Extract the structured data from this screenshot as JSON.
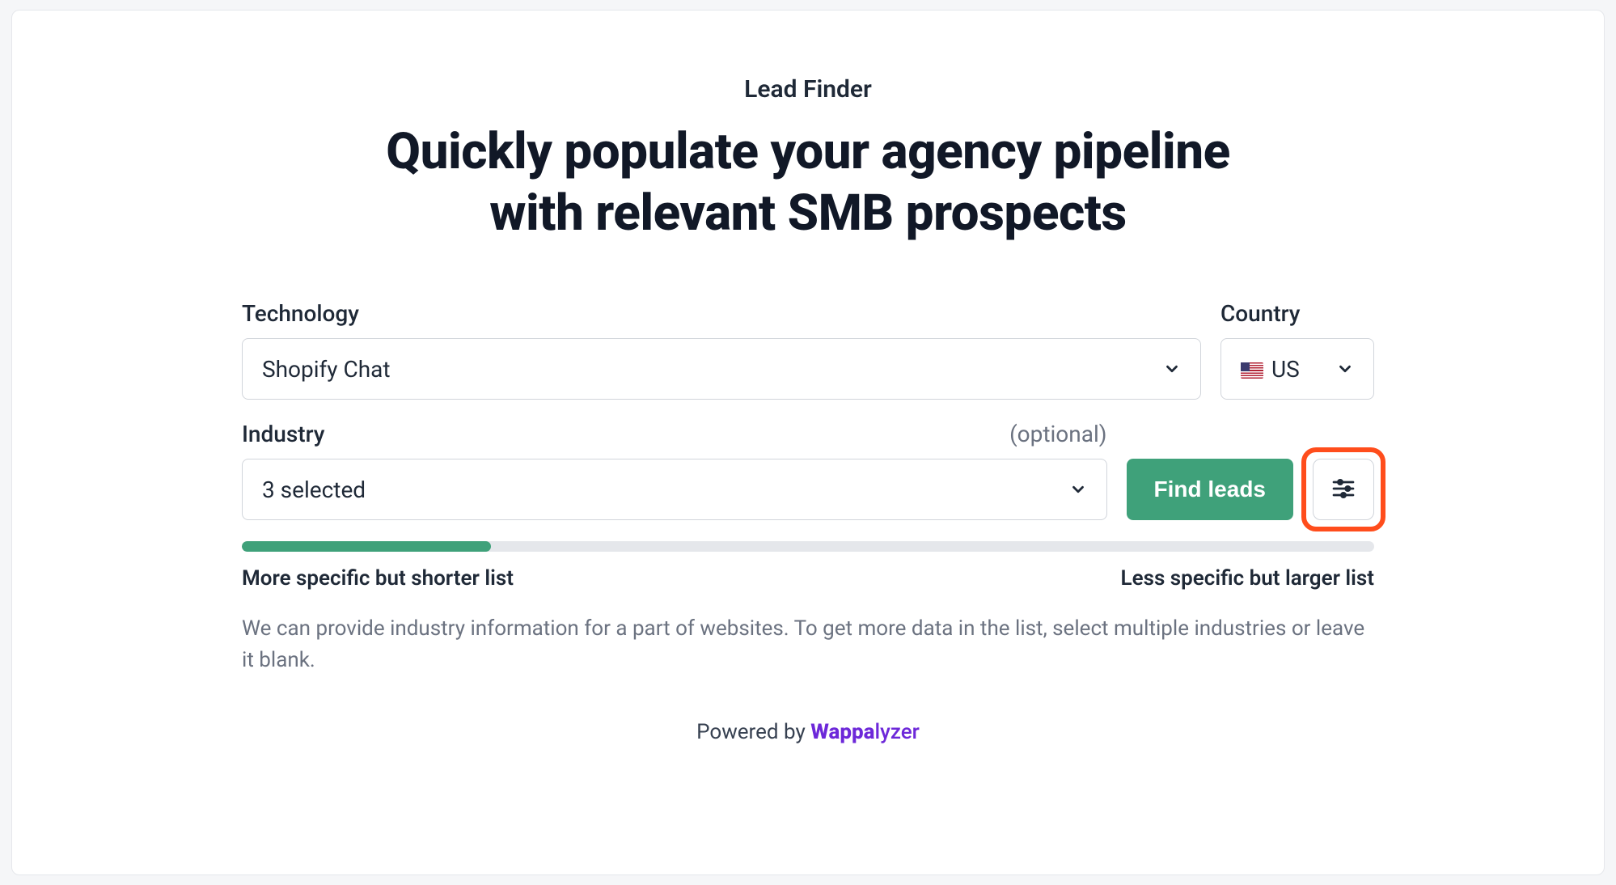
{
  "header": {
    "supertitle": "Lead Finder",
    "title_line1": "Quickly populate your agency pipeline",
    "title_line2": "with relevant SMB prospects"
  },
  "form": {
    "technology": {
      "label": "Technology",
      "value": "Shopify Chat"
    },
    "country": {
      "label": "Country",
      "value": "US",
      "flag": "us"
    },
    "industry": {
      "label": "Industry",
      "optional_label": "(optional)",
      "value": "3 selected"
    },
    "find_leads_label": "Find leads"
  },
  "slider": {
    "percent": 22,
    "left_label": "More specific but shorter list",
    "right_label": "Less specific but larger list"
  },
  "helper_text": "We can provide industry information for a part of websites. To get more data in the list, select multiple industries or leave it blank.",
  "powered_by": {
    "prefix": "Powered by ",
    "brand_bold": "Wappa",
    "brand_rest": "lyzer"
  }
}
